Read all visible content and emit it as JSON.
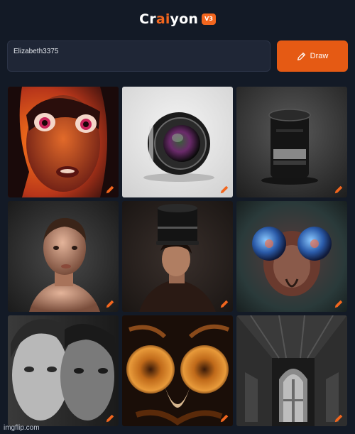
{
  "app": {
    "logo_prefix": "Cr",
    "logo_accent": "ai",
    "logo_suffix": "yon",
    "version_badge": "V3",
    "accent_color": "#f2661e",
    "background_color": "#131a26"
  },
  "prompt": {
    "value": "Elizabeth3375"
  },
  "draw_button": {
    "label": "Draw",
    "icon": "pencil-icon"
  },
  "results": [
    {
      "subject": "glowing-eyed woman portrait",
      "edit_icon": "pencil-icon"
    },
    {
      "subject": "camera lens on white",
      "edit_icon": "pencil-icon"
    },
    {
      "subject": "telephoto lens on grey",
      "edit_icon": "pencil-icon"
    },
    {
      "subject": "woman portrait dark background",
      "edit_icon": "pencil-icon"
    },
    {
      "subject": "woman with lens hat",
      "edit_icon": "pencil-icon"
    },
    {
      "subject": "insect macro face",
      "edit_icon": "pencil-icon"
    },
    {
      "subject": "two women black and white",
      "edit_icon": "pencil-icon"
    },
    {
      "subject": "insect eyes macro",
      "edit_icon": "pencil-icon"
    },
    {
      "subject": "cathedral interior",
      "edit_icon": "pencil-icon"
    }
  ],
  "watermark": "imgflip.com"
}
